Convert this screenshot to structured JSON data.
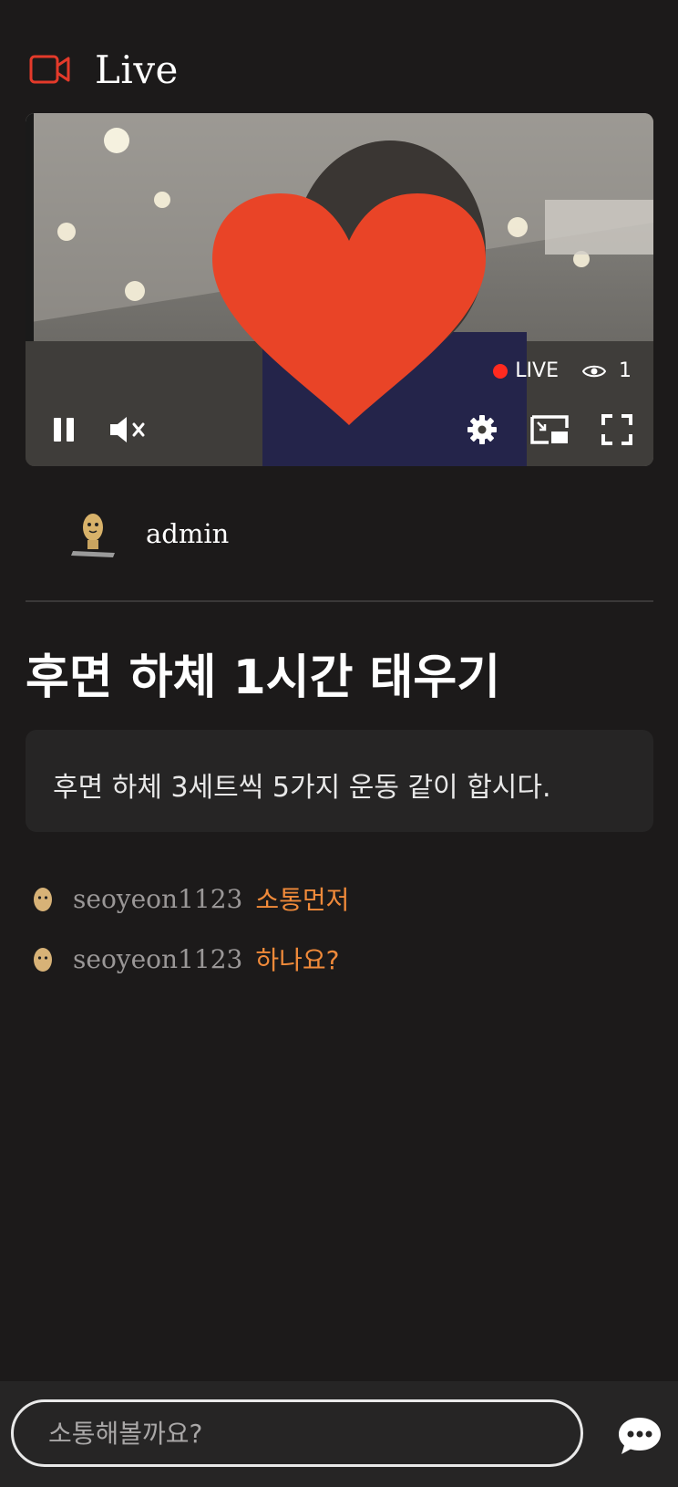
{
  "header": {
    "title": "Live",
    "icon": "video-camera-icon",
    "accent": "#e43a2a"
  },
  "player": {
    "live_label": "LIVE",
    "viewer_count": "1",
    "controls": [
      "pause-icon",
      "mute-icon",
      "settings-gear-icon",
      "picture-in-picture-icon",
      "fullscreen-icon"
    ],
    "overlay": "heart"
  },
  "author": {
    "name": "admin",
    "avatar": "potato-character-avatar"
  },
  "stream": {
    "title": "후면 하체 1시간 태우기",
    "description": "후면 하체 3세트씩 5가지 운동 같이 합시다."
  },
  "chat": {
    "messages": [
      {
        "user": "seoyeon1123",
        "text": "소통먼저"
      },
      {
        "user": "seoyeon1123",
        "text": "하나요?"
      }
    ],
    "input_placeholder": "소통해볼까요?",
    "send_icon": "chat-bubble-icon"
  }
}
